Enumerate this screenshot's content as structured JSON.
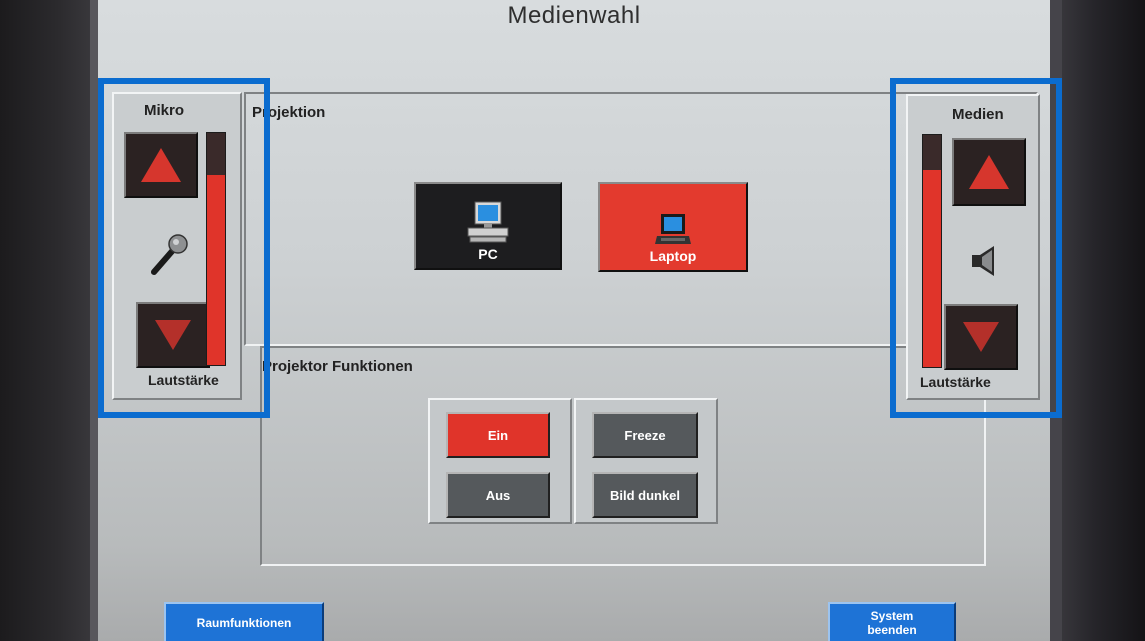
{
  "screen": {
    "title": "Medienwahl"
  },
  "mic_panel": {
    "title": "Mikro",
    "volume_label": "Lautstärke",
    "level_fraction": 0.82,
    "icons": {
      "up": "triangle-up-icon",
      "down": "triangle-down-icon",
      "mic": "microphone-icon"
    }
  },
  "media_panel": {
    "title": "Medien",
    "volume_label": "Lautstärke",
    "level_fraction": 0.85,
    "icons": {
      "up": "triangle-up-icon",
      "down": "triangle-down-icon",
      "speaker": "speaker-icon"
    }
  },
  "projection": {
    "title": "Projektion",
    "sources": [
      {
        "label": "PC",
        "icon": "desktop-computer-icon",
        "selected": false
      },
      {
        "label": "Laptop",
        "icon": "laptop-icon",
        "selected": true
      }
    ]
  },
  "projector_functions": {
    "title": "Projektor Funktionen",
    "power": [
      {
        "label": "Ein",
        "active": true
      },
      {
        "label": "Aus",
        "active": false
      }
    ],
    "image": [
      {
        "label": "Freeze",
        "active": false
      },
      {
        "label": "Bild dunkel",
        "active": false
      }
    ]
  },
  "footer": {
    "left_button": "Raumfunktionen",
    "right_button_line1": "System",
    "right_button_line2": "beenden"
  },
  "colors": {
    "accent_red": "#e0342a",
    "button_gray": "#55595c",
    "button_blue": "#1e73d6",
    "highlight_blue": "#0b6ccf"
  }
}
